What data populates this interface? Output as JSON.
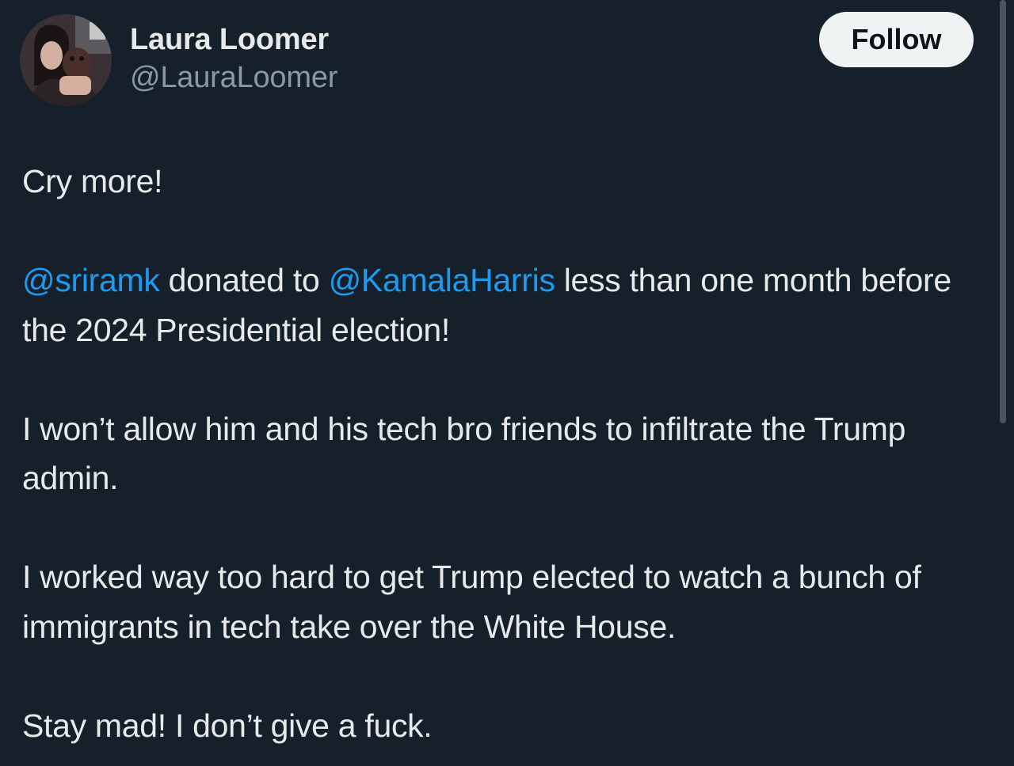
{
  "author": {
    "name": "Laura Loomer",
    "handle": "@LauraLoomer",
    "avatar_icon": "profile-photo"
  },
  "actions": {
    "follow_label": "Follow"
  },
  "tweet": {
    "p1": "Cry more!",
    "p2": {
      "mention1": "@sriramk",
      "text1": " donated to ",
      "mention2": "@KamalaHarris",
      "text2": " less than one month before the 2024 Presidential election!"
    },
    "p3": "I won’t allow him and his tech bro friends to infiltrate the Trump admin.",
    "p4": "I worked way too hard to get Trump elected to watch a bunch of immigrants in tech take over the White House.",
    "p5": "Stay mad! I don’t give a fuck."
  },
  "colors": {
    "background": "#15202b",
    "text": "#e7e9ea",
    "secondary_text": "#8b98a5",
    "mention": "#1d9bf0",
    "follow_button_bg": "#eff3f4"
  }
}
